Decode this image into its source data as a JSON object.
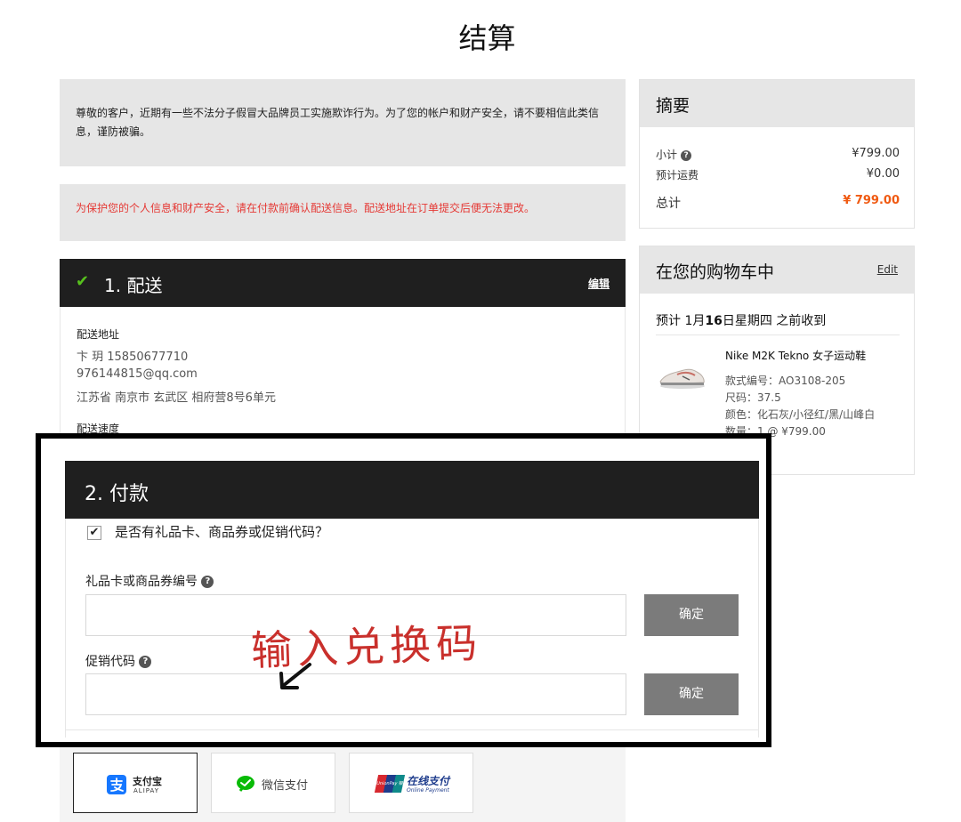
{
  "page": {
    "title": "结算"
  },
  "notices": {
    "warning": "尊敬的客户，近期有一些不法分子假冒大品牌员工实施欺诈行为。为了您的帐户和财产安全，请不要相信此类信息，谨防被骗。",
    "confirm": "为保护您的个人信息和财产安全，请在付款前确认配送信息。配送地址在订单提交后便无法更改。"
  },
  "shipping": {
    "step_title": "1. 配送",
    "edit_label": "编辑",
    "address_label": "配送地址",
    "name_phone": "卞 玥 15850677710",
    "email": "976144815@qq.com",
    "address": "江苏省 南京市 玄武区 相府营8号6单元",
    "speed_label": "配送速度"
  },
  "summary": {
    "title": "摘要",
    "subtotal_label": "小计",
    "subtotal_value": "¥799.00",
    "shipping_label": "预计运费",
    "shipping_value": "¥0.00",
    "total_label": "总计",
    "total_value": "¥ 799.00"
  },
  "cart": {
    "title": "在您的购物车中",
    "edit_label": "Edit",
    "delivery_prefix": "预计 1月",
    "delivery_day": "16",
    "delivery_suffix": "日星期四 之前收到",
    "item": {
      "name": "Nike M2K Tekno 女子运动鞋",
      "style": "款式编号：AO3108-205",
      "size": "尺码：37.5",
      "color": "颜色：化石灰/小径红/黑/山峰白",
      "qty": "数量：1 @ ¥799.00"
    }
  },
  "payment": {
    "step_title": "2. 付款",
    "gift_checkbox_label": "是否有礼品卡、商品券或促销代码？",
    "gift_checked": true,
    "giftcard_label": "礼品卡或商品券编号",
    "promo_label": "促销代码",
    "confirm_label": "确定",
    "annotation": "输入兑换码",
    "options": {
      "alipay": "支付宝",
      "alipay_sub": "ALIPAY",
      "wechat": "微信支付",
      "unionpay": "在线支付",
      "unionpay_sub": "Online Payment",
      "unionpay_badge": "UnionPay 银联"
    }
  },
  "colors": {
    "accent_orange": "#f05a12",
    "check_green": "#57c11d",
    "notice_red": "#e53935",
    "annotation_red": "#c9302c",
    "dark_header": "#1f1f1f",
    "alipay_blue": "#1677ff",
    "wechat_green": "#09bb07",
    "unionpay_blue": "#1e3c8c"
  }
}
